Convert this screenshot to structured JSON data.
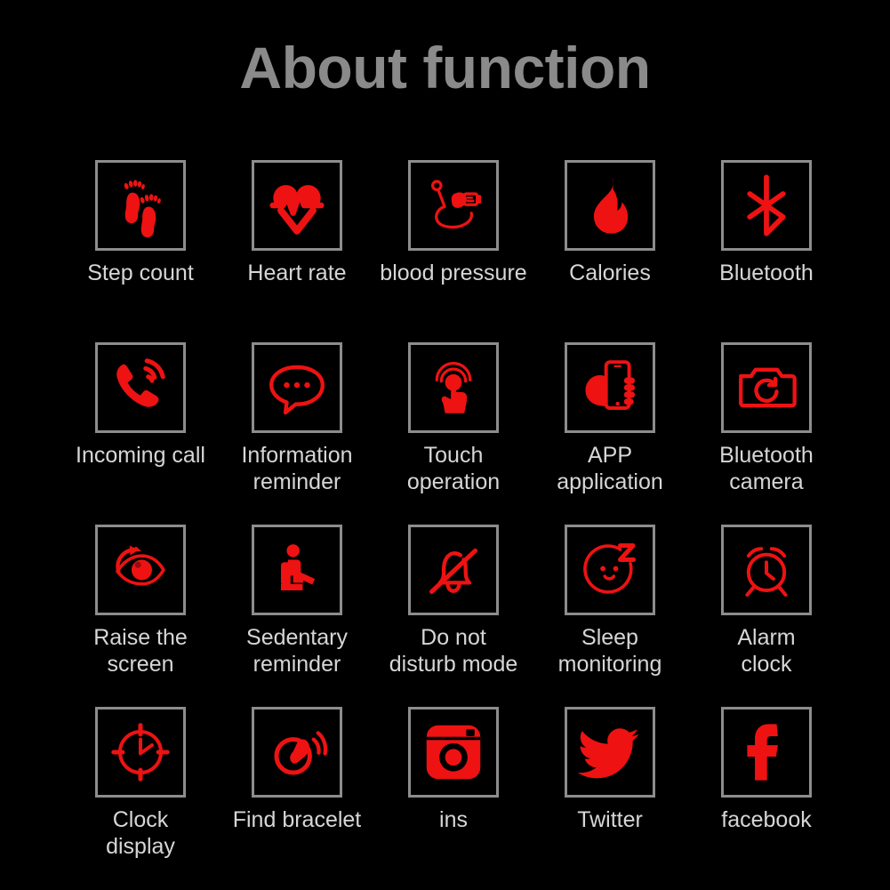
{
  "page": {
    "title": "About function",
    "background_color": "#000000",
    "title_color": "#8a8a8a",
    "label_color": "#d6d6d6",
    "icon_color": "#ee1212",
    "icon_box_border_color": "#8d8d8d"
  },
  "grid": {
    "columns": 5,
    "rows": 4,
    "items": [
      {
        "label": "Step count",
        "icon": "footprints-icon"
      },
      {
        "label": "Heart rate",
        "icon": "heart-pulse-icon"
      },
      {
        "label": "blood pressure",
        "icon": "blood-pressure-monitor-icon"
      },
      {
        "label": "Calories",
        "icon": "flame-icon"
      },
      {
        "label": "Bluetooth",
        "icon": "bluetooth-icon"
      },
      {
        "label": "Incoming call",
        "icon": "ringing-phone-icon"
      },
      {
        "label": "Information\nreminder",
        "icon": "speech-bubble-icon"
      },
      {
        "label": "Touch\noperation",
        "icon": "touch-finger-icon"
      },
      {
        "label": "APP\napplication",
        "icon": "hand-holding-phone-icon"
      },
      {
        "label": "Bluetooth\ncamera",
        "icon": "camera-icon"
      },
      {
        "label": "Raise the\nscreen",
        "icon": "eye-rotate-icon"
      },
      {
        "label": "Sedentary\nreminder",
        "icon": "seated-person-icon"
      },
      {
        "label": "Do not\ndisturb mode",
        "icon": "bell-muted-icon"
      },
      {
        "label": "Sleep\nmonitoring",
        "icon": "sleeping-face-z-icon"
      },
      {
        "label": "Alarm\nclock",
        "icon": "alarm-clock-icon"
      },
      {
        "label": "Clock\ndisplay",
        "icon": "clock-face-icon"
      },
      {
        "label": "Find bracelet",
        "icon": "vibrating-bracelet-icon"
      },
      {
        "label": "ins",
        "icon": "instagram-icon"
      },
      {
        "label": "Twitter",
        "icon": "twitter-bird-icon"
      },
      {
        "label": "facebook",
        "icon": "facebook-f-icon"
      }
    ]
  }
}
